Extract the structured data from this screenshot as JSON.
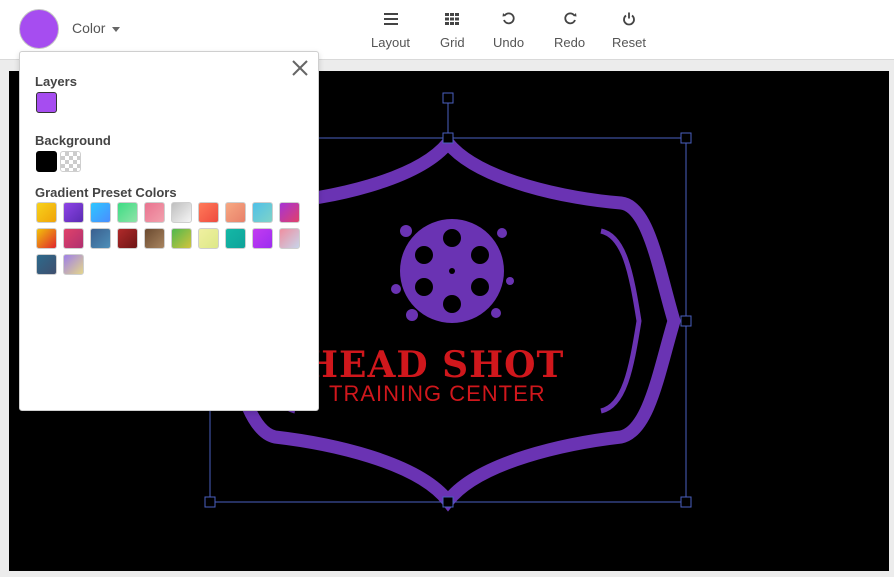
{
  "toolbar": {
    "color_label": "Color",
    "current_color": "#a64df0",
    "tools": [
      {
        "label": "Layout",
        "icon": "layout-icon"
      },
      {
        "label": "Grid",
        "icon": "grid-icon"
      },
      {
        "label": "Undo",
        "icon": "undo-icon"
      },
      {
        "label": "Redo",
        "icon": "redo-icon"
      },
      {
        "label": "Reset",
        "icon": "power-icon"
      }
    ]
  },
  "panel": {
    "layers_title": "Layers",
    "layer_colors": [
      "#a64df0"
    ],
    "background_title": "Background",
    "background_colors": [
      "#000000",
      "transparent"
    ],
    "gradient_title": "Gradient Preset Colors",
    "gradients": [
      [
        "#f7d21b",
        "#f0a30a"
      ],
      [
        "#8e44e6",
        "#5a2bb3"
      ],
      [
        "#2ec7ff",
        "#4a8dff"
      ],
      [
        "#3ddc84",
        "#8fe3a8"
      ],
      [
        "#e9738f",
        "#f2a0ad"
      ],
      [
        "#bfbfbf",
        "#f5f5f5"
      ],
      [
        "#ff7a59",
        "#ee4b3f"
      ],
      [
        "#f7a882",
        "#e8806a"
      ],
      [
        "#4fc0e8",
        "#7fd3c8"
      ],
      [
        "#a633d6",
        "#e0426a"
      ],
      [
        "#f2c20a",
        "#e0262c"
      ],
      [
        "#e0426a",
        "#b03070"
      ],
      [
        "#3a5f8f",
        "#4d8fb8"
      ],
      [
        "#b02a2a",
        "#6e1515"
      ],
      [
        "#6b4a30",
        "#a88560"
      ],
      [
        "#4fb84f",
        "#d2c43c"
      ],
      [
        "#f0f0a0",
        "#dde888"
      ],
      [
        "#14b8a6",
        "#0fa39a"
      ],
      [
        "#c33cf0",
        "#9c2df0"
      ],
      [
        "#ef8fa0",
        "#c7d4ea"
      ],
      [
        "#2d6a8c",
        "#3f4f6e"
      ],
      [
        "#9e7fe8",
        "#e4d68a"
      ]
    ]
  },
  "canvas": {
    "background": "#000000",
    "logo_line1": "HEAD SHOT",
    "logo_line2": "TRAINING CENTER",
    "logo_frame_color": "#6a33b3",
    "logo_text_color": "#d0171c"
  }
}
